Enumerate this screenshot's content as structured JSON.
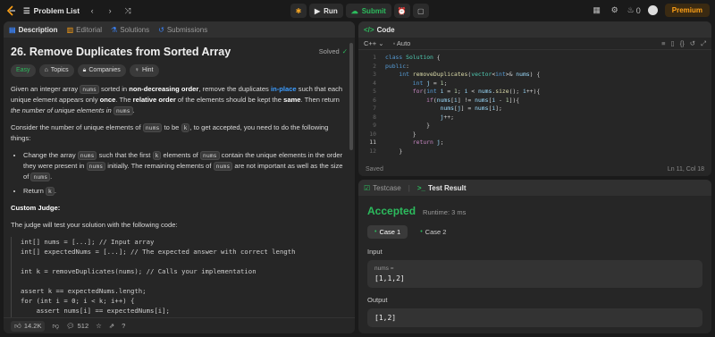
{
  "topbar": {
    "problem_list": "Problem List",
    "run": "Run",
    "submit": "Submit",
    "streak": "0",
    "premium": "Premium"
  },
  "left_tabs": [
    "Description",
    "Editorial",
    "Solutions",
    "Submissions"
  ],
  "problem": {
    "title": "26. Remove Duplicates from Sorted Array",
    "solved": "Solved",
    "tags": [
      "Easy",
      "Topics",
      "Companies",
      "Hint"
    ],
    "p1": {
      "a": "Given an integer array ",
      "code1": "nums",
      "b": " sorted in ",
      "bold1": "non-decreasing order",
      "c": ", remove the duplicates ",
      "link": "in-place",
      "d": " such that each unique element appears only ",
      "bold2": "once",
      "e": ". The ",
      "bold3": "relative order",
      "f": " of the elements should be kept the ",
      "bold4": "same",
      "g": ". Then return ",
      "ital": "the number of unique elements in",
      "code2": "nums",
      "h": "."
    },
    "p2": {
      "a": "Consider the number of unique elements of ",
      "code1": "nums",
      "b": " to be ",
      "code2": "k",
      "c": ", to get accepted, you need to do the following things:"
    },
    "li1": {
      "a": "Change the array ",
      "code1": "nums",
      "b": " such that the first ",
      "code2": "k",
      "c": " elements of ",
      "code3": "nums",
      "d": " contain the unique elements in the order they were present in ",
      "code4": "nums",
      "e": " initially. The remaining elements of ",
      "code5": "nums",
      "f": " are not important as well as the size of ",
      "code6": "nums",
      "g": "."
    },
    "li2": {
      "a": "Return ",
      "code1": "k",
      "b": "."
    },
    "judge_title": "Custom Judge:",
    "judge_text": "The judge will test your solution with the following code:",
    "judge_code": "int[] nums = [...]; // Input array\nint[] expectedNums = [...]; // The expected answer with correct length\n\nint k = removeDuplicates(nums); // Calls your implementation\n\nassert k == expectedNums.length;\nfor (int i = 0; i < k; i++) {\n    assert nums[i] == expectedNums[i];\n}"
  },
  "footer": {
    "likes": "14.2K",
    "comments": "512"
  },
  "code_panel": {
    "tab": "Code",
    "lang": "C++",
    "mode": "Auto",
    "status": "Saved",
    "cursor": "Ln 11, Col 18",
    "line_numbers": [
      "1",
      "2",
      "3",
      "4",
      "5",
      "6",
      "7",
      "8",
      "9",
      "10",
      "11",
      "12"
    ]
  },
  "result_panel": {
    "tab1": "Testcase",
    "tab2": "Test Result",
    "verdict": "Accepted",
    "runtime": "Runtime: 3 ms",
    "case1": "Case 1",
    "case2": "Case 2",
    "input_label": "Input",
    "input_key": "nums =",
    "input_value": "[1,1,2]",
    "output_label": "Output",
    "output_value": "[1,2]"
  },
  "colors": {
    "accent": "#ffa116",
    "success": "#2cbb5d",
    "link": "#3b9cff"
  }
}
